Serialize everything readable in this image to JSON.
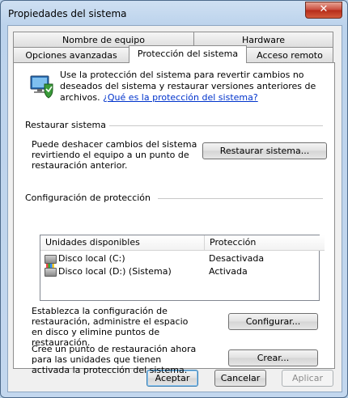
{
  "window": {
    "title": "Propiedades del sistema",
    "close_glyph": "✕"
  },
  "tabs": {
    "row1": [
      "Nombre de equipo",
      "Hardware"
    ],
    "row2": [
      "Opciones avanzadas",
      "Protección del sistema",
      "Acceso remoto"
    ],
    "active": "Protección del sistema"
  },
  "intro": {
    "text": "Use la protección del sistema para revertir cambios no deseados del sistema y restaurar versiones anteriores de archivos. ",
    "link": "¿Qué es la protección del sistema?"
  },
  "restore": {
    "heading": "Restaurar sistema",
    "description": "Puede deshacer cambios del sistema revirtiendo el equipo a un punto de restauración anterior.",
    "button": "Restaurar sistema..."
  },
  "protection": {
    "heading": "Configuración de protección",
    "columns": [
      "Unidades disponibles",
      "Protección"
    ],
    "rows": [
      {
        "drive": "Disco local (C:)",
        "status": "Desactivada"
      },
      {
        "drive": "Disco local (D:) (Sistema)",
        "status": "Activada"
      }
    ],
    "config_text": "Establezca la configuración de restauración, administre el espacio en disco y elimine puntos de restauración.",
    "config_button": "Configurar...",
    "create_text": "Cree un punto de restauración ahora para las unidades que tienen activada la protección del sistema.",
    "create_button": "Crear..."
  },
  "footer": {
    "ok": "Aceptar",
    "cancel": "Cancelar",
    "apply": "Aplicar"
  }
}
